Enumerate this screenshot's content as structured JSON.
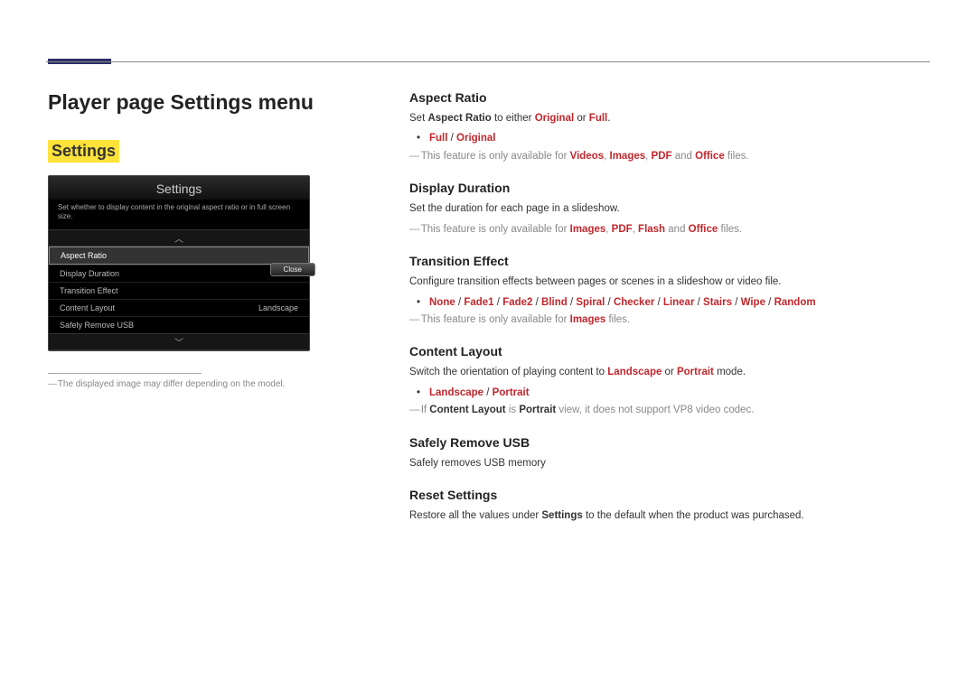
{
  "page_title": "Player page Settings menu",
  "section_name": "Settings",
  "settings_panel": {
    "title": "Settings",
    "hint": "Set whether to display content in the original aspect ratio or in full screen size.",
    "rows": [
      {
        "label": "Aspect Ratio",
        "value": "",
        "selected": true
      },
      {
        "label": "Display Duration",
        "value": ""
      },
      {
        "label": "Transition Effect",
        "value": ""
      },
      {
        "label": "Content Layout",
        "value": "Landscape"
      },
      {
        "label": "Safely Remove USB",
        "value": ""
      }
    ],
    "close_label": "Close"
  },
  "image_note": "The displayed image may differ depending on the model.",
  "sections": {
    "aspect_ratio": {
      "heading": "Aspect Ratio",
      "desc_pre": "Set ",
      "desc_term": "Aspect Ratio",
      "desc_mid": " to either ",
      "desc_opt1": "Original",
      "desc_or": " or ",
      "desc_opt2": "Full",
      "desc_post": ".",
      "bullet_opt1": "Full",
      "bullet_sep": " / ",
      "bullet_opt2": "Original",
      "note_pre": "This feature is only available for ",
      "note_items": [
        "Videos",
        "Images",
        "PDF",
        "Office"
      ],
      "note_joins": [
        ", ",
        ", ",
        " and "
      ],
      "note_post": " files."
    },
    "display_duration": {
      "heading": "Display Duration",
      "desc": "Set the duration for each page in a slideshow.",
      "note_pre": "This feature is only available for ",
      "note_items": [
        "Images",
        "PDF",
        "Flash",
        "Office"
      ],
      "note_joins": [
        ", ",
        ", ",
        " and "
      ],
      "note_post": " files."
    },
    "transition_effect": {
      "heading": "Transition Effect",
      "desc": "Configure transition effects between pages or scenes in a slideshow or video file.",
      "options": [
        "None",
        "Fade1",
        "Fade2",
        "Blind",
        "Spiral",
        "Checker",
        "Linear",
        "Stairs",
        "Wipe",
        "Random"
      ],
      "sep": " / ",
      "note_pre": "This feature is only available for ",
      "note_item": "Images",
      "note_post": " files."
    },
    "content_layout": {
      "heading": "Content Layout",
      "desc_pre": "Switch the orientation of playing content to ",
      "desc_opt1": "Landscape",
      "desc_or": " or ",
      "desc_opt2": "Portrait",
      "desc_post": " mode.",
      "bullet_opt1": "Landscape",
      "bullet_sep": " / ",
      "bullet_opt2": "Portrait",
      "note_pre": "If ",
      "note_term1": "Content Layout",
      "note_mid": " is ",
      "note_term2": "Portrait",
      "note_post": " view, it does not support VP8 video codec."
    },
    "safely_remove": {
      "heading": "Safely Remove USB",
      "desc": "Safely removes USB memory"
    },
    "reset_settings": {
      "heading": "Reset Settings",
      "desc_pre": "Restore all the values under ",
      "desc_term": "Settings",
      "desc_post": " to the default when the product was purchased."
    }
  }
}
